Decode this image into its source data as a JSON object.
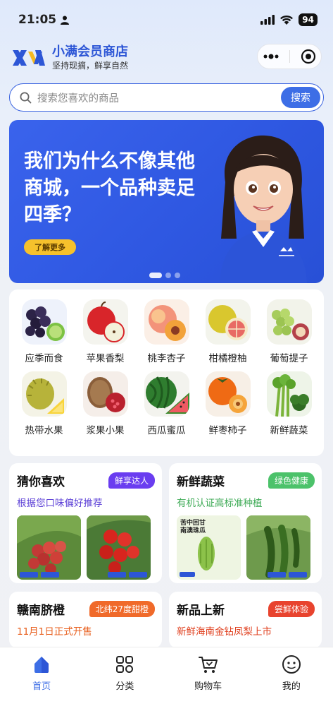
{
  "status_bar": {
    "time": "21:05",
    "battery": "94"
  },
  "header": {
    "title": "小满会员商店",
    "subtitle": "坚持现摘，鲜享自然"
  },
  "search": {
    "placeholder": "搜索您喜欢的商品",
    "button": "搜索"
  },
  "banner": {
    "headline": "我们为什么不像其他商城，一个品种卖足四季？",
    "cta": "了解更多",
    "active_slide": 1,
    "slide_count": 3
  },
  "categories": [
    {
      "label": "应季而食",
      "icon": "grapes-lime"
    },
    {
      "label": "苹果香梨",
      "icon": "apple"
    },
    {
      "label": "桃李杏子",
      "icon": "peach"
    },
    {
      "label": "柑橘橙柚",
      "icon": "pomelo"
    },
    {
      "label": "葡萄提子",
      "icon": "green-grapes"
    },
    {
      "label": "热带水果",
      "icon": "durian-pineapple"
    },
    {
      "label": "浆果小果",
      "icon": "kiwi-pomegranate"
    },
    {
      "label": "西瓜蜜瓜",
      "icon": "watermelon"
    },
    {
      "label": "鲜枣柿子",
      "icon": "persimmon"
    },
    {
      "label": "新鲜蔬菜",
      "icon": "celery-broccoli"
    }
  ],
  "promos": [
    {
      "title": "猜你喜欢",
      "tag": "鲜享达人",
      "tag_color": "#6a3df0",
      "subtitle": "根据您口味偏好推荐",
      "subtitle_color": "#5b3fd6"
    },
    {
      "title": "新鲜蔬菜",
      "tag": "绿色健康",
      "tag_color": "#4cc26a",
      "subtitle": "有机认证高标准种植",
      "subtitle_color": "#3daa55"
    },
    {
      "title": "赣南脐橙",
      "tag": "北纬27度甜橙",
      "tag_color": "#f06a2a",
      "subtitle": "11月1日正式开售",
      "subtitle_color": "#e8601f"
    },
    {
      "title": "新品上新",
      "tag": "尝鲜体验",
      "tag_color": "#e8432e",
      "subtitle": "新鲜海南金钻凤梨上市",
      "subtitle_color": "#e0401f"
    }
  ],
  "promo_image_text": {
    "bitter_melon_title": "苦中回甘 南澳珠瓜"
  },
  "tabbar": [
    {
      "label": "首页",
      "icon": "home-icon",
      "active": true
    },
    {
      "label": "分类",
      "icon": "category-icon",
      "active": false
    },
    {
      "label": "购物车",
      "icon": "cart-icon",
      "active": false
    },
    {
      "label": "我的",
      "icon": "profile-icon",
      "active": false
    }
  ],
  "colors": {
    "brand": "#2d56d6",
    "accent": "#3d6ee6",
    "banner": "#2f58e2",
    "cta": "#f6c12c"
  }
}
